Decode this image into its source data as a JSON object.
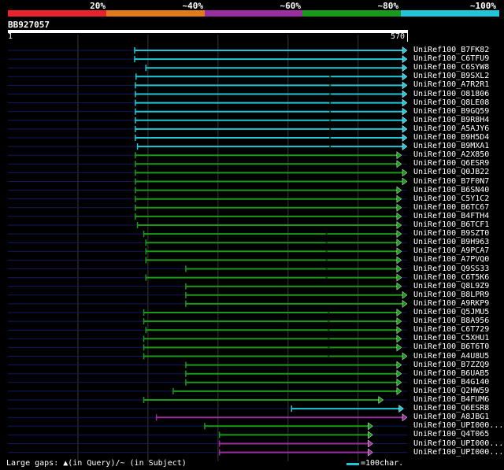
{
  "legend": [
    {
      "label": "20%",
      "color": "#e8232e"
    },
    {
      "label": "~40%",
      "color": "#e07a1b"
    },
    {
      "label": "~60%",
      "color": "#9b2ea0"
    },
    {
      "label": "~80%",
      "color": "#1a9a1a"
    },
    {
      "label": "~100%",
      "color": "#21c7d8"
    }
  ],
  "query": {
    "id": "BB927057",
    "start": "1",
    "end": "570",
    "length": 570
  },
  "colors": {
    "background": "#000000",
    "backbone": "#0f1a5e",
    "gridline": "#3a3a3a",
    "cyan": "#21c7d8",
    "green": "#1a9a1a",
    "purple": "#9b2ea0"
  },
  "hits": [
    {
      "label": "UniRef100_B7FK82",
      "start": 181,
      "end": 570,
      "color": "cyan",
      "gap": 0
    },
    {
      "label": "UniRef100_C6TFU9",
      "start": 181,
      "end": 570,
      "color": "cyan",
      "gap": 0
    },
    {
      "label": "UniRef100_C6SYW8",
      "start": 197,
      "end": 570,
      "color": "cyan",
      "gap": 0
    },
    {
      "label": "UniRef100_B9SXL2",
      "start": 183,
      "end": 570,
      "color": "cyan",
      "gap": 460
    },
    {
      "label": "UniRef100_A7R2R1",
      "start": 182,
      "end": 570,
      "color": "cyan",
      "gap": 460
    },
    {
      "label": "UniRef100_O81806",
      "start": 182,
      "end": 570,
      "color": "cyan",
      "gap": 460
    },
    {
      "label": "UniRef100_Q8LE08",
      "start": 182,
      "end": 570,
      "color": "cyan",
      "gap": 460
    },
    {
      "label": "UniRef100_B9GQ59",
      "start": 182,
      "end": 570,
      "color": "cyan",
      "gap": 460
    },
    {
      "label": "UniRef100_B9R8H4",
      "start": 182,
      "end": 570,
      "color": "cyan",
      "gap": 460
    },
    {
      "label": "UniRef100_A5AJY6",
      "start": 182,
      "end": 570,
      "color": "cyan",
      "gap": 460
    },
    {
      "label": "UniRef100_B9H5D4",
      "start": 182,
      "end": 570,
      "color": "cyan",
      "gap": 460
    },
    {
      "label": "UniRef100_B9MXA1",
      "start": 185,
      "end": 570,
      "color": "cyan",
      "gap": 460
    },
    {
      "label": "UniRef100_A2X850",
      "start": 182,
      "end": 562,
      "color": "green",
      "gap": 0
    },
    {
      "label": "UniRef100_Q6ESR9",
      "start": 182,
      "end": 562,
      "color": "green",
      "gap": 0
    },
    {
      "label": "UniRef100_Q0JB22",
      "start": 182,
      "end": 570,
      "color": "green",
      "gap": 0
    },
    {
      "label": "UniRef100_B7F0N7",
      "start": 182,
      "end": 570,
      "color": "green",
      "gap": 0
    },
    {
      "label": "UniRef100_B6SN40",
      "start": 182,
      "end": 562,
      "color": "green",
      "gap": 0
    },
    {
      "label": "UniRef100_C5Y1C2",
      "start": 182,
      "end": 562,
      "color": "green",
      "gap": 0
    },
    {
      "label": "UniRef100_B6TC67",
      "start": 182,
      "end": 562,
      "color": "green",
      "gap": 0
    },
    {
      "label": "UniRef100_B4FTH4",
      "start": 182,
      "end": 562,
      "color": "green",
      "gap": 0
    },
    {
      "label": "UniRef100_B6TCF1",
      "start": 185,
      "end": 562,
      "color": "green",
      "gap": 0
    },
    {
      "label": "UniRef100_B9SZT0",
      "start": 194,
      "end": 562,
      "color": "green",
      "gap": 455
    },
    {
      "label": "UniRef100_B9H963",
      "start": 197,
      "end": 562,
      "color": "green",
      "gap": 455
    },
    {
      "label": "UniRef100_A9PCA7",
      "start": 197,
      "end": 562,
      "color": "green",
      "gap": 455
    },
    {
      "label": "UniRef100_A7PVQ0",
      "start": 197,
      "end": 562,
      "color": "green",
      "gap": 455
    },
    {
      "label": "UniRef100_Q9SS33",
      "start": 254,
      "end": 562,
      "color": "green",
      "gap": 455
    },
    {
      "label": "UniRef100_C6T5K6",
      "start": 197,
      "end": 562,
      "color": "green",
      "gap": 455
    },
    {
      "label": "UniRef100_Q8L9Z9",
      "start": 254,
      "end": 562,
      "color": "green",
      "gap": 0
    },
    {
      "label": "UniRef100_B8LPR9",
      "start": 254,
      "end": 570,
      "color": "green",
      "gap": 0
    },
    {
      "label": "UniRef100_A9RKP9",
      "start": 254,
      "end": 570,
      "color": "green",
      "gap": 0
    },
    {
      "label": "UniRef100_Q5JMU5",
      "start": 194,
      "end": 562,
      "color": "green",
      "gap": 458
    },
    {
      "label": "UniRef100_B8A956",
      "start": 194,
      "end": 562,
      "color": "green",
      "gap": 458
    },
    {
      "label": "UniRef100_C6T729",
      "start": 197,
      "end": 562,
      "color": "green",
      "gap": 458
    },
    {
      "label": "UniRef100_C5XHU1",
      "start": 194,
      "end": 562,
      "color": "green",
      "gap": 458
    },
    {
      "label": "UniRef100_B6T6T0",
      "start": 194,
      "end": 562,
      "color": "green",
      "gap": 458
    },
    {
      "label": "UniRef100_A4U8U5",
      "start": 194,
      "end": 570,
      "color": "green",
      "gap": 458
    },
    {
      "label": "UniRef100_B7ZZQ9",
      "start": 254,
      "end": 562,
      "color": "green",
      "gap": 0
    },
    {
      "label": "UniRef100_B6UAB5",
      "start": 254,
      "end": 562,
      "color": "green",
      "gap": 0
    },
    {
      "label": "UniRef100_B4G140",
      "start": 254,
      "end": 562,
      "color": "green",
      "gap": 0
    },
    {
      "label": "UniRef100_Q2HW59",
      "start": 236,
      "end": 562,
      "color": "green",
      "gap": 0
    },
    {
      "label": "UniRef100_B4FUM6",
      "start": 194,
      "end": 536,
      "color": "green",
      "gap": 0
    },
    {
      "label": "UniRef100_Q6ESR8",
      "start": 405,
      "end": 565,
      "color": "cyan",
      "gap": 0
    },
    {
      "label": "UniRef100_A8JBG1",
      "start": 212,
      "end": 570,
      "color": "purple",
      "gap": 0
    },
    {
      "label": "UniRef100_UPI000...",
      "start": 281,
      "end": 521,
      "color": "green",
      "gap": 0
    },
    {
      "label": "UniRef100_Q4T065",
      "start": 302,
      "end": 521,
      "color": "green",
      "gap": 0
    },
    {
      "label": "UniRef100_UPI000...",
      "start": 302,
      "end": 521,
      "color": "purple",
      "gap": 0
    },
    {
      "label": "UniRef100_UPI000...",
      "start": 302,
      "end": 521,
      "color": "purple",
      "gap": 0
    }
  ],
  "footer": {
    "gaps_text": "Large gaps: ▲(in Query)/~ (in Subject)",
    "scale_text": "=100char."
  }
}
